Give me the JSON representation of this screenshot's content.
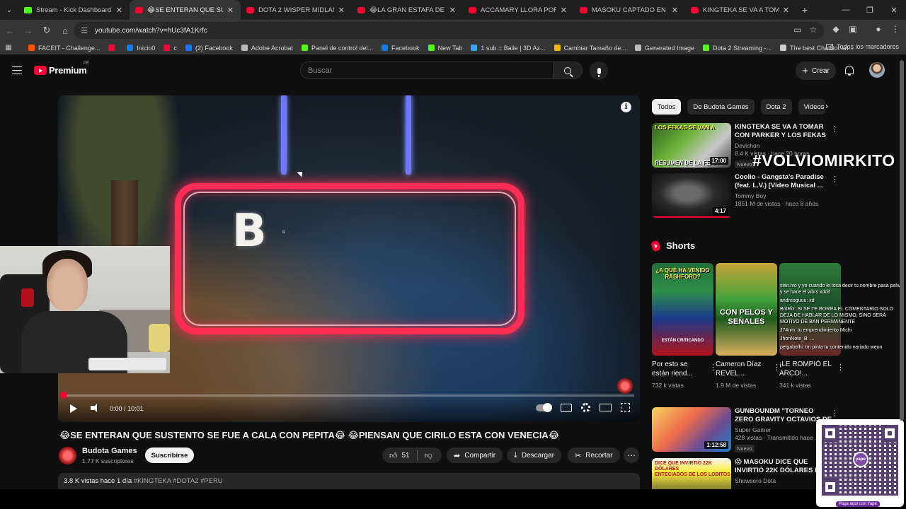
{
  "browser": {
    "tabs": [
      {
        "title": "Stream - Kick Dashboard",
        "icon": "kick"
      },
      {
        "title": "😂SE ENTERAN QUE SUSTENTO",
        "icon": "youtube",
        "active": true
      },
      {
        "title": "DOTA 2 WISPER MIDLANER DE",
        "icon": "youtube"
      },
      {
        "title": "😂LA GRAN ESTAFA DE KICK PE",
        "icon": "youtube"
      },
      {
        "title": "ACCAMARY LLORA POR EMET",
        "icon": "youtube"
      },
      {
        "title": "MASOKU CAPTADO EN EL HA",
        "icon": "youtube"
      },
      {
        "title": "KINGTEKA SE VA A TOMAR CO",
        "icon": "youtube"
      }
    ],
    "url": "youtube.com/watch?v=hUc3fA1Krfc",
    "bookmarks": [
      {
        "label": "FACEIT - Challenge...",
        "color": "#ff5500"
      },
      {
        "label": "",
        "color": "#ff0033"
      },
      {
        "label": "Inicio0",
        "color": "#1877f2"
      },
      {
        "label": "c",
        "color": "#ff0033"
      },
      {
        "label": "(2) Facebook",
        "color": "#1877f2"
      },
      {
        "label": "Adobe Acrobat",
        "color": "#bbbbbb"
      },
      {
        "label": "Panel de control del...",
        "color": "#53fc18"
      },
      {
        "label": "Facebook",
        "color": "#1877f2"
      },
      {
        "label": "New Tab",
        "color": "#53fc18"
      },
      {
        "label": "1 sub = Baile | 3D Az...",
        "color": "#3aa0ff"
      },
      {
        "label": "Cambiar Tamaño de...",
        "color": "#f2b705"
      },
      {
        "label": "Generated Image",
        "color": "#bbbbbb"
      },
      {
        "label": "Dota 2 Streaming -...",
        "color": "#53fc18"
      },
      {
        "label": "The best ChatBot an...",
        "color": "#cccccc"
      }
    ],
    "all_bookmarks": "Todos los marcadores"
  },
  "masthead": {
    "brand": "Premium",
    "country": "PE",
    "search_placeholder": "Buscar",
    "create_label": "Crear"
  },
  "player": {
    "letter": "B",
    "small_char": "u",
    "current_time": "0:00",
    "duration": "10:01",
    "separator": "/",
    "progress": 0.0
  },
  "video": {
    "title": "😂SE ENTERAN QUE SUSTENTO SE FUE A CALA CON PEPITA😂 😂PIENSAN QUE CIRILO ESTA CON VENECIA😂",
    "channel": "Budota Games",
    "subscribers": "1.77 K suscriptores",
    "subscribe_label": "Suscribirse",
    "likes": "51",
    "share_label": "Compartir",
    "download_label": "Descargar",
    "clip_label": "Recortar",
    "views_date": "3.8 K vistas  hace 1 día",
    "tags": "#KINGTEKA #DOTA2 #PERU"
  },
  "sidebar": {
    "chips": [
      "Todos",
      "De Budota Games",
      "Dota 2",
      "Videos"
    ],
    "recs": [
      {
        "title": "KINGTEKA SE VA A TOMAR CON PARKER Y LOS FEKAS🔥...",
        "channel": "Devichon",
        "stats": "8.4 K vistas · hace 20 horas",
        "badge": "Nuevo",
        "duration": "17:00"
      },
      {
        "title": "Coolio - Gangsta's Paradise (feat. L.V.) [Video Musical ...",
        "channel": "Tommy Boy",
        "stats": "1851 M de vistas · hace 8 años",
        "badge": "",
        "duration": "4:17"
      }
    ],
    "overlay_tag": "#VOLVIOMIRKITO",
    "shorts_title": "Shorts",
    "shorts": [
      {
        "title": "Por esto se están riend...",
        "views": "732 k vistas",
        "thumb_top": "¿A QUÉ HA VENIDO RASHFORD?",
        "thumb_bottom": "ESTÁN CRITICANDO"
      },
      {
        "title": "Cameron Díaz REVEL...",
        "views": "1.9 M de vistas",
        "thumb_top": "",
        "thumb_bottom": "CON PELOS Y SEÑALES"
      },
      {
        "title": "¡LE ROMPIÓ EL ARCO!...",
        "views": "341 k vistas",
        "thumb_top": "",
        "thumb_bottom": ""
      }
    ],
    "recs_bottom": [
      {
        "title": "GUNBOUNDM \"TORNEO ZERO GRAVITY OCTAVIOS DE FIN...",
        "channel": "Super Gamer",
        "stats": "428 vistas · Transmitido hace ...",
        "badge": "Nuevo",
        "duration": "1:12:58"
      },
      {
        "title": "😱 MASOKU DICE QUE INVIRTIÓ 22K DÓLARES EN ...",
        "channel": "Showsero Dota",
        "stats": "",
        "badge": "",
        "duration": ""
      }
    ]
  },
  "chat": [
    "sian.ivo y yo cuando le toca decir tu nombre pasa paliva y se hace el wbrs xddd",
    "andreoguuu: xd",
    "BotRix: SI SE TE BORRA EL COMENTARIO SOLO DEJA DE HABLAR DE LO MISMO, SINO SERÁ MOTIVO DE BAN PERMANENTE",
    "J74nm: tu emprendimiento Michi",
    "JhonNote_B: ...",
    "pelgabolhi: tm pinta tu contenido variado weon"
  ],
  "qr": {
    "brand": "yape",
    "footer": "Paga aquí con Yape"
  },
  "colors": {
    "accent": "#ff0033",
    "neon": "#ff2d55",
    "background": "#0f0f0f"
  }
}
